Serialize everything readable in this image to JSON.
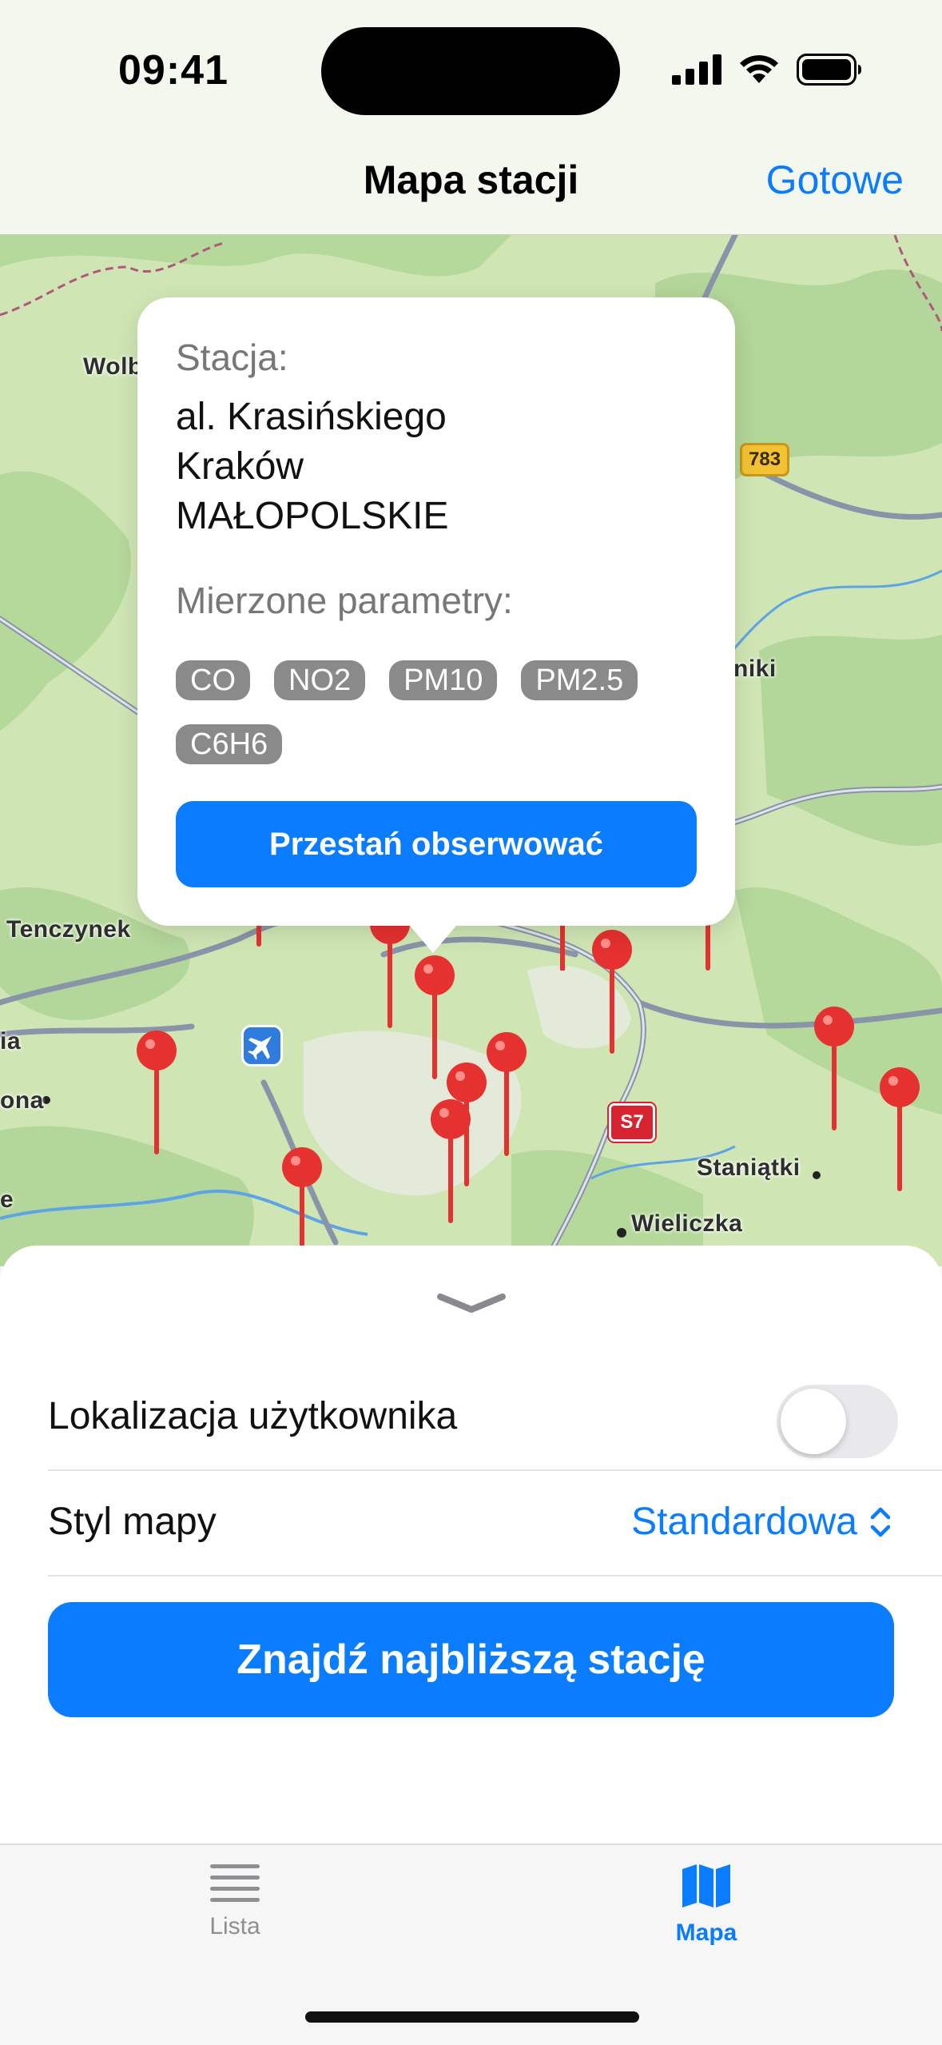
{
  "status_bar": {
    "time": "09:41"
  },
  "nav": {
    "title": "Mapa stacji",
    "done_label": "Gotowe"
  },
  "map": {
    "labels": {
      "wolb": "Wolb",
      "tenczynek": "Tenczynek",
      "nki": "niki",
      "ia": "ia",
      "ona": "ona",
      "e": "e",
      "staniatki": "Staniątki",
      "wieliczka": "Wieliczka",
      "road_783": "783",
      "road_s7": "S7"
    },
    "colors": {
      "land": "#cfe6b4",
      "forest": "#b3d69a",
      "road": "#8a94a8",
      "water": "#5da4e6",
      "pin": "#e5312f"
    }
  },
  "popup": {
    "station_label": "Stacja:",
    "street": "al. Krasińskiego",
    "city": "Kraków",
    "region": "MAŁOPOLSKIE",
    "params_label": "Mierzone parametry:",
    "params": [
      "CO",
      "NO2",
      "PM10",
      "PM2.5",
      "C6H6"
    ],
    "unfollow_button": "Przestań obserwować"
  },
  "sheet": {
    "user_location_label": "Lokalizacja użytkownika",
    "user_location_enabled": false,
    "map_style_label": "Styl mapy",
    "map_style_value": "Standardowa",
    "find_button": "Znajdź najbliższą stację"
  },
  "tabbar": {
    "tabs": [
      {
        "label": "Lista",
        "selected": false
      },
      {
        "label": "Mapa",
        "selected": true
      }
    ],
    "accent": "#0a7cff",
    "inactive": "#8e8e93"
  }
}
